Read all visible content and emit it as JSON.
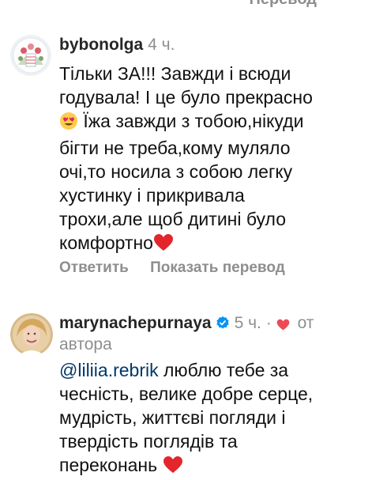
{
  "top_cutoff_text": "Перевод",
  "comments": [
    {
      "username": "bybonolga",
      "time": "4 ч.",
      "avatar_icon": "floral-avatar",
      "line1": "Тільки ЗА!!! Завжди і всюди",
      "line2": "годувала! І це було прекрасно",
      "line3": " Їжа завжди з тобою,нікуди",
      "line4": "бігти не треба,кому муляло",
      "line5": "очі,то носила з собою легку",
      "line6": "хустинку і прикривала",
      "line7": "трохи,але щоб дитині було",
      "line8": "комфортно",
      "action_reply": "Ответить",
      "action_translate": "Показать перевод"
    },
    {
      "username": "marynachepurnaya",
      "time": "5 ч.",
      "author_label_part1": "от",
      "author_label_part2": "автора",
      "mention": "@liliia.rebrik",
      "line1_rest": " люблю тебе за",
      "line2": "чесність, велике добре серце,",
      "line3": "мудрість, життєві погляди і",
      "line4": "твердість поглядів та",
      "line5": "переконань"
    }
  ],
  "colors": {
    "muted": "#8e8e8e",
    "mention": "#00376b",
    "heart": "#ed4956",
    "verified": "#0095f6"
  }
}
